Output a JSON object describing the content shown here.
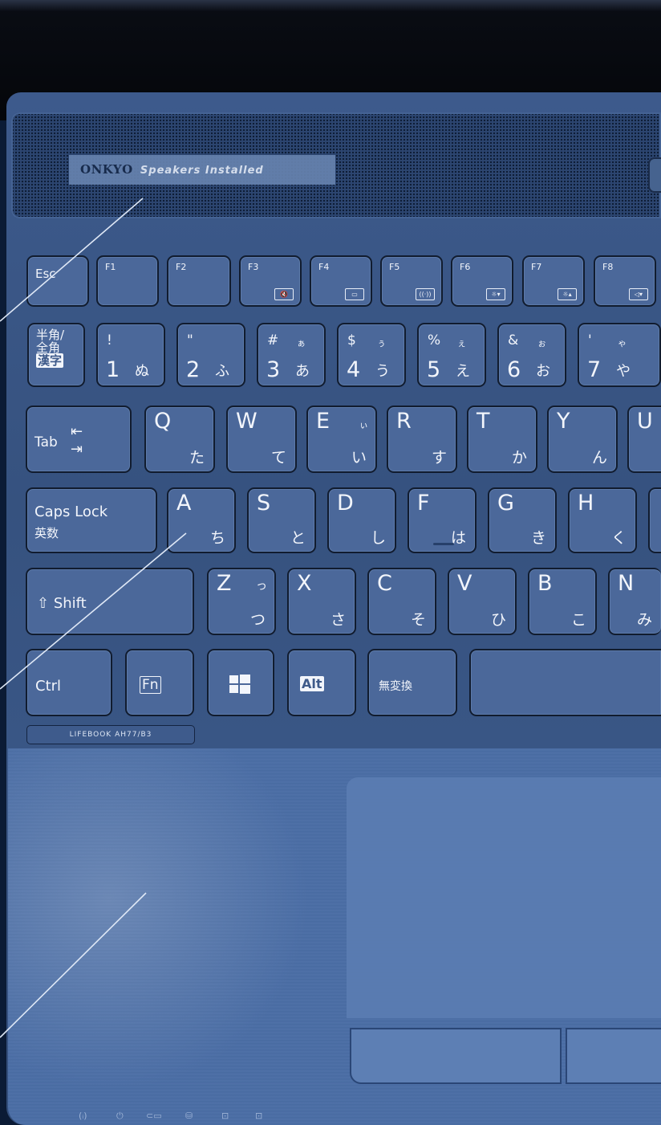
{
  "speaker_badge": {
    "brand": "ONKYO",
    "text": "Speakers Installed"
  },
  "model_label": "LIFEBOOK AH77/B3",
  "fn_row": [
    {
      "id": "esc",
      "label": "Esc",
      "icon": ""
    },
    {
      "id": "f1",
      "label": "F1",
      "icon": ""
    },
    {
      "id": "f2",
      "label": "F2",
      "icon": ""
    },
    {
      "id": "f3",
      "label": "F3",
      "icon": "mute-icon"
    },
    {
      "id": "f4",
      "label": "F4",
      "icon": "touchpad-icon"
    },
    {
      "id": "f5",
      "label": "F5",
      "icon": "wireless-icon"
    },
    {
      "id": "f6",
      "label": "F6",
      "icon": "brightness-down-icon"
    },
    {
      "id": "f7",
      "label": "F7",
      "icon": "brightness-up-icon"
    },
    {
      "id": "f8",
      "label": "F8",
      "icon": "volume-down-icon"
    }
  ],
  "num_row": {
    "hankaku_lines": [
      "半角/",
      "全角"
    ],
    "hankaku_kanji": "漢字",
    "keys": [
      {
        "s1": "!",
        "s2": "",
        "n": "1",
        "k": "ぬ"
      },
      {
        "s1": "\"",
        "s2": "",
        "n": "2",
        "k": "ふ"
      },
      {
        "s1": "#",
        "s2": "ぁ",
        "n": "3",
        "k": "あ"
      },
      {
        "s1": "$",
        "s2": "ぅ",
        "n": "4",
        "k": "う"
      },
      {
        "s1": "%",
        "s2": "ぇ",
        "n": "5",
        "k": "え"
      },
      {
        "s1": "&",
        "s2": "ぉ",
        "n": "6",
        "k": "お"
      },
      {
        "s1": "'",
        "s2": "ゃ",
        "n": "7",
        "k": "や"
      }
    ]
  },
  "tab_row": {
    "tab": "Tab",
    "keys": [
      {
        "l": "Q",
        "k": "た",
        "small": ""
      },
      {
        "l": "W",
        "k": "て",
        "small": ""
      },
      {
        "l": "E",
        "k": "い",
        "small": "ぃ"
      },
      {
        "l": "R",
        "k": "す",
        "small": ""
      },
      {
        "l": "T",
        "k": "か",
        "small": ""
      },
      {
        "l": "Y",
        "k": "ん",
        "small": ""
      },
      {
        "l": "U",
        "k": "",
        "small": ""
      }
    ]
  },
  "caps_row": {
    "caps": "Caps Lock",
    "caps_sub": "英数",
    "keys": [
      {
        "l": "A",
        "k": "ち"
      },
      {
        "l": "S",
        "k": "と"
      },
      {
        "l": "D",
        "k": "し"
      },
      {
        "l": "F",
        "k": "は"
      },
      {
        "l": "G",
        "k": "き"
      },
      {
        "l": "H",
        "k": "く"
      }
    ]
  },
  "shift_row": {
    "shift": "Shift",
    "keys": [
      {
        "l": "Z",
        "k": "つ",
        "small": "っ"
      },
      {
        "l": "X",
        "k": "さ",
        "small": ""
      },
      {
        "l": "C",
        "k": "そ",
        "small": ""
      },
      {
        "l": "V",
        "k": "ひ",
        "small": ""
      },
      {
        "l": "B",
        "k": "こ",
        "small": ""
      },
      {
        "l": "N",
        "k": "み",
        "small": ""
      }
    ]
  },
  "bottom_row": {
    "ctrl": "Ctrl",
    "fn": "Fn",
    "alt": "Alt",
    "muhenkan": "無変換"
  },
  "indicators": [
    "wireless-icon",
    "power-icon",
    "battery-icon",
    "disk-icon",
    "num-lock-icon",
    "caps-lock-icon"
  ],
  "indicator_glyphs": [
    "(ᵢ)",
    "⏻",
    "⊂▭",
    "⛁",
    "⊡",
    "⊡"
  ]
}
